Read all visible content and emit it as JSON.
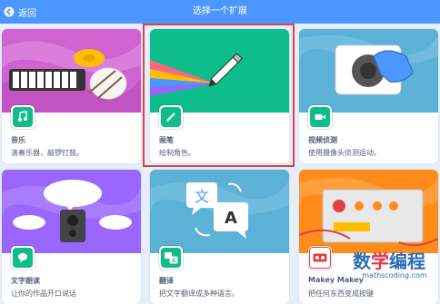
{
  "header": {
    "back_label": "返回",
    "title": "选择一个扩展"
  },
  "extensions": [
    {
      "name": "音乐",
      "desc": "演奏乐器，敲锣打鼓。",
      "color": "#c94fd2"
    },
    {
      "name": "画笔",
      "desc": "绘制角色。",
      "color": "#0fbd8c"
    },
    {
      "name": "视频侦测",
      "desc": "使用摄像头侦测运动。",
      "color": "#4c97ff"
    },
    {
      "name": "文字朗读",
      "desc": "让你的作品开口说话",
      "color": "#9966ff"
    },
    {
      "name": "翻译",
      "desc": "把文字翻译成多种语言。",
      "color": "#5cb1d6"
    },
    {
      "name": "Makey Makey",
      "desc": "把任何东西变成按键",
      "color": "#ff661a"
    }
  ],
  "watermark": {
    "chars": [
      "数",
      "学",
      "编",
      "程"
    ],
    "url": "mathscoding.com"
  }
}
